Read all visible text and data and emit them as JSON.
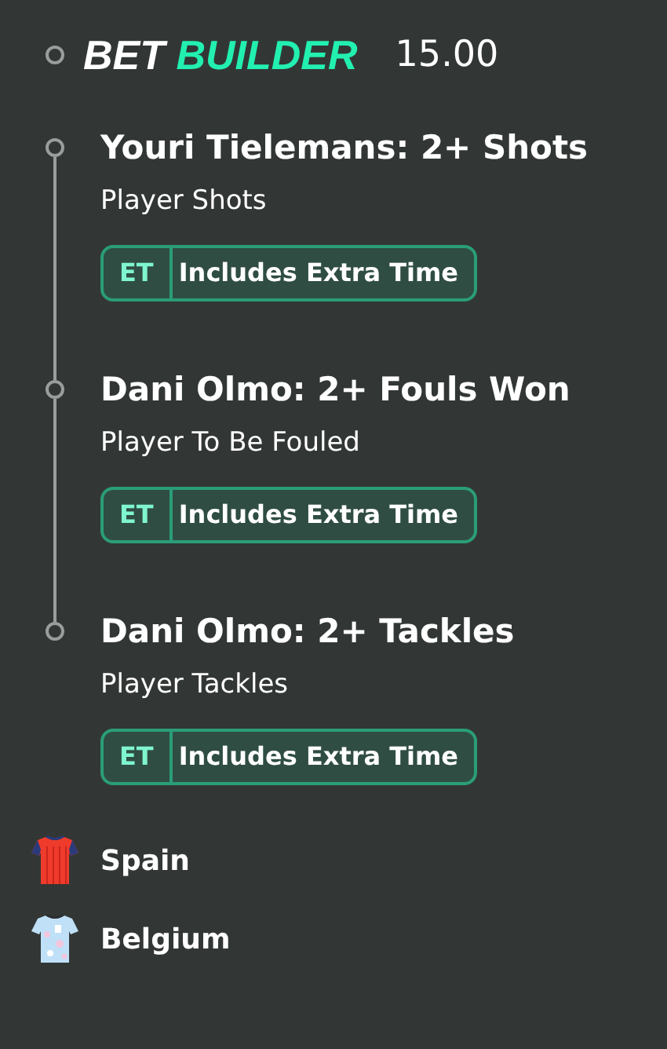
{
  "header": {
    "title_part_1": "BET",
    "title_part_2": "BUILDER",
    "odds": "15.00"
  },
  "selections": [
    {
      "title": "Youri Tielemans: 2+ Shots",
      "market": "Player Shots",
      "badge": {
        "code": "ET",
        "label": "Includes Extra Time"
      }
    },
    {
      "title": "Dani Olmo: 2+ Fouls Won",
      "market": "Player To Be Fouled",
      "badge": {
        "code": "ET",
        "label": "Includes Extra Time"
      }
    },
    {
      "title": "Dani Olmo: 2+ Tackles",
      "market": "Player Tackles",
      "badge": {
        "code": "ET",
        "label": "Includes Extra Time"
      }
    }
  ],
  "teams": [
    {
      "name": "Spain",
      "kind": "striped"
    },
    {
      "name": "Belgium",
      "kind": "speckled"
    }
  ]
}
